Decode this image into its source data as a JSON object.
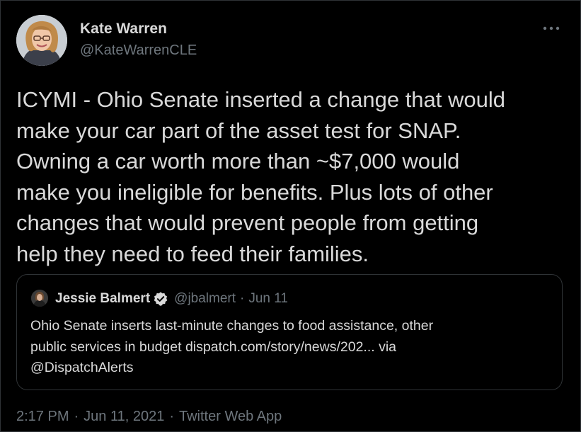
{
  "author": {
    "name": "Kate Warren",
    "handle": "@KateWarrenCLE",
    "avatar_icon": "profile-photo"
  },
  "more_icon": "more-horizontal-icon",
  "tweet": {
    "text": "ICYMI - Ohio Senate inserted a change that would\nmake your car part of the asset test for SNAP.\nOwning a car worth more than ~$7,000 would\nmake you ineligible for benefits. Plus lots of other\nchanges that would prevent people from getting\nhelp they need to feed their families."
  },
  "quoted_tweet": {
    "name": "Jessie Balmert",
    "verified_icon": "verified-badge-icon",
    "handle": "@jbalmert",
    "separator": "·",
    "date": "Jun 11",
    "text": "Ohio Senate inserts last-minute changes to food assistance, other\npublic services in budget dispatch.com/story/news/202... via\n@DispatchAlerts"
  },
  "meta": {
    "time": "2:17 PM",
    "sep1": "·",
    "date": "Jun 11, 2021",
    "sep2": "·",
    "app": "Twitter Web App"
  },
  "colors": {
    "background": "#000000",
    "text": "#d9d9d9",
    "secondary": "#6e767d",
    "border": "#2f3336",
    "verified": "#d9d9d9"
  }
}
